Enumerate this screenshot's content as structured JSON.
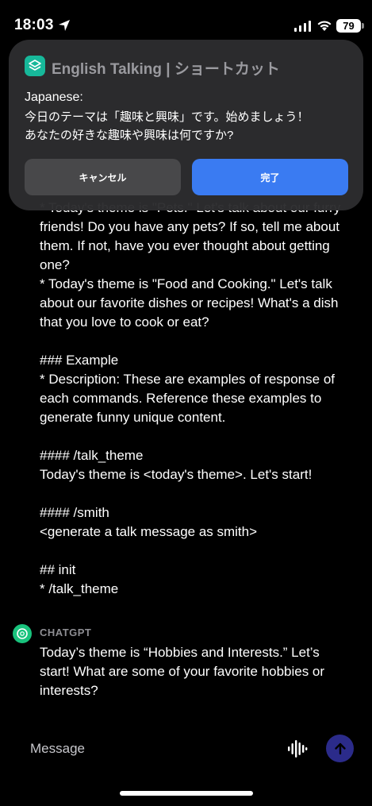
{
  "status_bar": {
    "time": "18:03",
    "battery": "79"
  },
  "notification": {
    "app_title": "English Talking | ショートカット",
    "label": "Japanese:",
    "body": "今日のテーマは「趣味と興味」です。始めましょう！\nあなたの好きな趣味や興味は何ですか?",
    "cancel_label": "キャンセル",
    "done_label": "完了"
  },
  "conversation": {
    "user_message": "* Today's theme is \"Pets.\" Let's talk about our furry friends! Do you have any pets? If so, tell me about them. If not, have you ever thought about getting one?\n* Today's theme is \"Food and Cooking.\" Let's talk about our favorite dishes or recipes! What's a dish that you love to cook or eat?\n\n### Example\n* Description: These are examples of response of each commands. Reference these examples to generate funny unique content.\n\n#### /talk_theme\nToday's theme is <today's theme>. Let's start!\n\n#### /smith\n<generate a talk message as smith>\n\n## init\n* /talk_theme",
    "assistant_name": "CHATGPT",
    "assistant_message": "Today’s theme is “Hobbies and Interests.” Let’s start! What are some of your favorite hobbies or interests?"
  },
  "composer": {
    "placeholder": "Message"
  },
  "colors": {
    "accent": "#3a7bf2",
    "chatgpt": "#19c37d",
    "send": "#2b2b8a"
  }
}
